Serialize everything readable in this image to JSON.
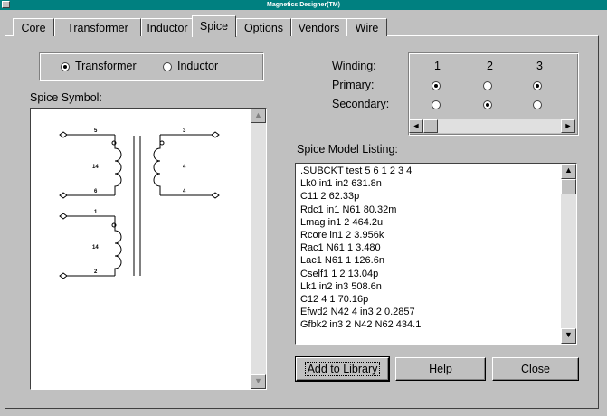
{
  "window": {
    "title": "Magnetics Designer(TM)"
  },
  "tabs": [
    "Core",
    "Transformer",
    "Inductor",
    "Spice",
    "Options",
    "Vendors",
    "Wire"
  ],
  "active_tab": "Spice",
  "mode": {
    "options": [
      "Transformer",
      "Inductor"
    ],
    "selected": "Transformer"
  },
  "spice_symbol": {
    "label": "Spice Symbol:",
    "pins": {
      "p5": "5",
      "p6": "6",
      "p3": "3",
      "p4": "4",
      "p1": "1",
      "p2": "2"
    },
    "turns": {
      "primary_top": "14",
      "secondary": "4",
      "primary_bottom": "14"
    }
  },
  "winding": {
    "label": "Winding:",
    "primary_label": "Primary:",
    "secondary_label": "Secondary:",
    "columns": [
      "1",
      "2",
      "3"
    ],
    "primary": [
      true,
      false,
      true
    ],
    "secondary": [
      false,
      true,
      false
    ]
  },
  "listing": {
    "label": "Spice Model Listing:",
    "lines": [
      ".SUBCKT test 5 6 1 2 3 4",
      "Lk0 in1 in2 631.8n",
      "C11 2 62.33p",
      "Rdc1 in1 N61 80.32m",
      "Lmag in1 2 464.2u",
      "Rcore in1 2 3.956k",
      "Rac1 N61 1 3.480",
      "Lac1 N61 1 126.6n",
      "Cself1 1 2 13.04p",
      "Lk1 in2 in3 508.6n",
      "C12 4 1 70.16p",
      "Efwd2 N42 4 in3 2 0.2857",
      "Gfbk2 in3 2 N42 N62 434.1"
    ]
  },
  "buttons": {
    "add": "Add to Library",
    "help": "Help",
    "close": "Close"
  },
  "icons": {
    "up": "▲",
    "down": "▼",
    "left": "◄",
    "right": "►"
  },
  "colors": {
    "face": "#c0c0c0",
    "titlebar": "#008080"
  }
}
